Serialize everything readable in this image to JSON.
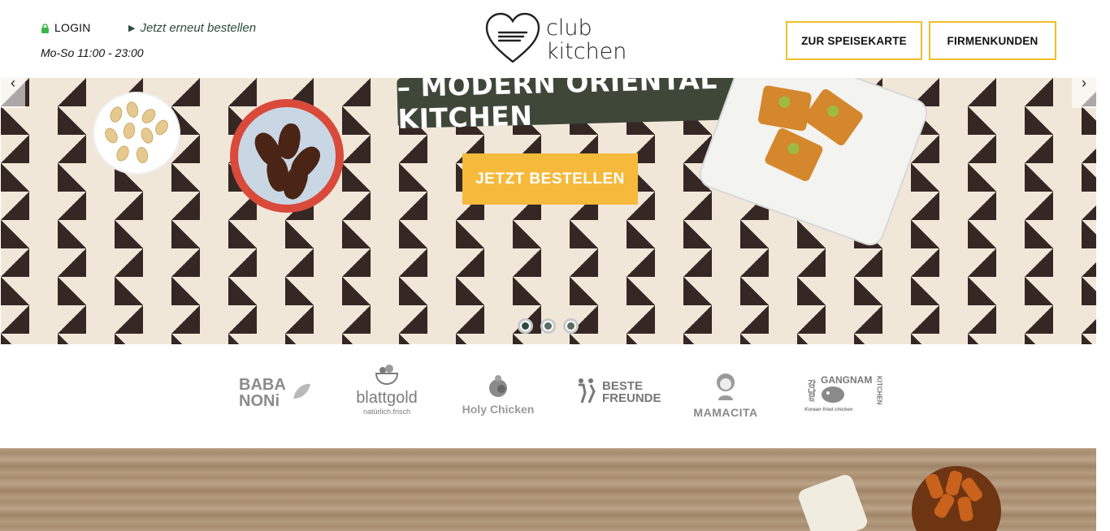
{
  "header": {
    "login_label": "LOGIN",
    "reorder_label": "Jetzt erneut bestellen",
    "hours": "Mo-So 11:00 - 23:00",
    "logo_line1": "club",
    "logo_line2": "kitchen",
    "menu_button": "ZUR SPEISEKARTE",
    "business_button": "FIRMENKUNDEN"
  },
  "hero": {
    "banner_text": "– MODERN ORIENTAL KITCHEN",
    "cta_label": "JETZT BESTELLEN",
    "prev_arrow": "‹",
    "next_arrow": "›",
    "slides_count": 3,
    "active_slide": 1
  },
  "brands": {
    "baba_line1": "BABA",
    "baba_line2": "NONi",
    "blattgold": "blattgold",
    "blattgold_tagline": "natürlich.frisch",
    "holy_chicken": "Holy Chicken",
    "beste_line1": "BESTE",
    "beste_line2": "FREUNDE",
    "mamacita": "MAMACITA",
    "gangnam": "GANGNAM",
    "gangnam_kitchen": "KITCHEN",
    "gangnam_tagline": "Korean fried chicken",
    "gangnam_hangul": "강남#"
  },
  "colors": {
    "accent_yellow": "#f0be2c",
    "cta_yellow": "#f5b93b",
    "dark_green": "#2f4a3e",
    "banner_green": "#3f4739",
    "lock_green": "#3cb54a"
  }
}
